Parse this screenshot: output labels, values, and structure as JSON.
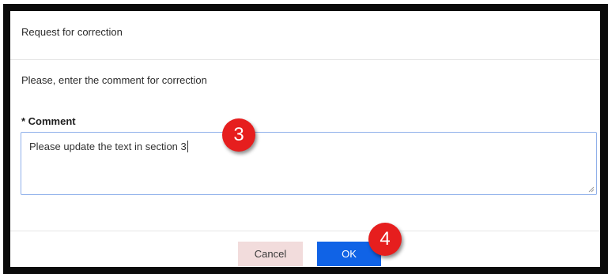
{
  "dialog": {
    "title": "Request for correction",
    "instruction": "Please, enter the comment for correction",
    "comment_label": "* Comment",
    "comment_value": "Please update the text in section 3",
    "cancel_label": "Cancel",
    "ok_label": "OK"
  },
  "annotations": {
    "step_comment": "3",
    "step_ok": "4"
  },
  "colors": {
    "ok_button": "#1063e6",
    "cancel_button": "#f2dcdc",
    "annotation_badge": "#e61e1e",
    "input_focus_border": "#8fb0ea"
  }
}
